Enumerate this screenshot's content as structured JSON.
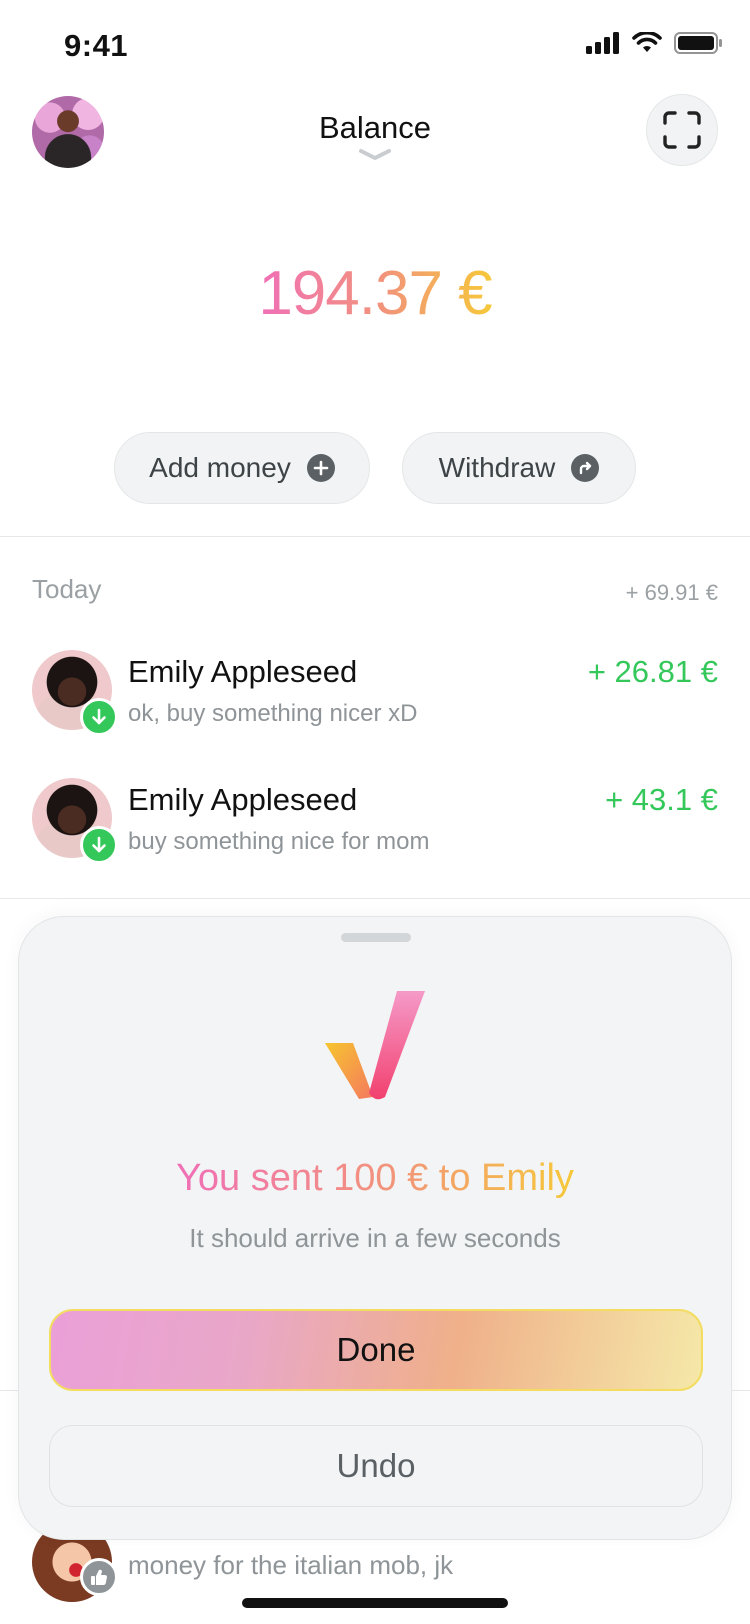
{
  "status_bar": {
    "time": "9:41"
  },
  "header": {
    "title": "Balance"
  },
  "balance": {
    "amount": "194.37 €"
  },
  "actions": {
    "add_money_label": "Add money",
    "withdraw_label": "Withdraw"
  },
  "section": {
    "label": "Today",
    "total": "+ 69.91 €"
  },
  "transactions": [
    {
      "name": "Emily Appleseed",
      "note": "ok, buy something nicer xD",
      "amount": "+ 26.81 €"
    },
    {
      "name": "Emily Appleseed",
      "note": "buy something nice for mom",
      "amount": "+ 43.1 €"
    }
  ],
  "partially_hidden_row": {
    "note": "money for the italian mob, jk"
  },
  "sheet": {
    "title": "You sent 100 € to Emily",
    "subtitle": "It should arrive in a few seconds",
    "done_label": "Done",
    "undo_label": "Undo"
  },
  "colors": {
    "accent_pink": "#f06fb7",
    "accent_orange": "#f29579",
    "accent_yellow": "#f6c83a",
    "positive_green": "#34c759"
  }
}
